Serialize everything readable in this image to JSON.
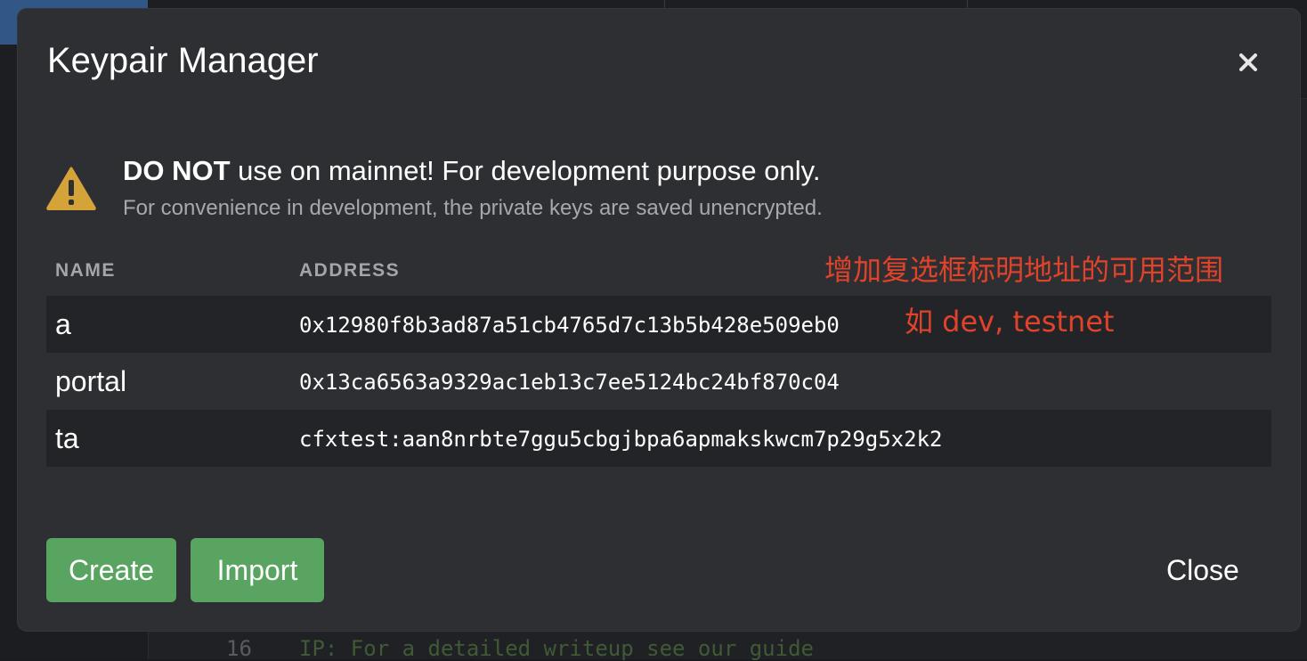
{
  "modal": {
    "title": "Keypair Manager",
    "close_icon": "close-icon"
  },
  "warning": {
    "icon": "warning-triangle-icon",
    "title_bold": "DO NOT",
    "title_rest": " use on mainnet! For development purpose only.",
    "subtitle": "For convenience in development, the private keys are saved unencrypted."
  },
  "table": {
    "headers": {
      "name": "NAME",
      "address": "ADDRESS"
    },
    "rows": [
      {
        "name": "a",
        "address": "0x12980f8b3ad87a51cb4765d7c13b5b428e509eb0"
      },
      {
        "name": "portal",
        "address": "0x13ca6563a9329ac1eb13c7ee5124bc24bf870c04"
      },
      {
        "name": "ta",
        "address": "cfxtest:aan8nrbte7ggu5cbgjbpa6apmakskwcm7p29g5x2k2"
      }
    ]
  },
  "annotation": {
    "line1": "增加复选框标明地址的可用范围",
    "line2": "如 dev, testnet",
    "color": "#e0432a"
  },
  "footer": {
    "create_label": "Create",
    "import_label": "Import",
    "close_label": "Close"
  },
  "background": {
    "line_number": "16",
    "code_text": "IP: For a detailed writeup see our guide"
  },
  "colors": {
    "modal_bg": "#2e2f33",
    "button_green": "#5aa461",
    "warning_yellow": "#d4a43a"
  }
}
